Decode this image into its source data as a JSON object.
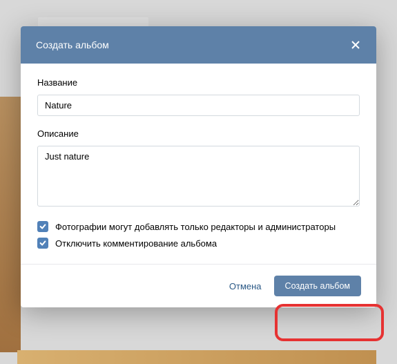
{
  "modal": {
    "title": "Создать альбом",
    "name_label": "Название",
    "name_value": "Nature",
    "description_label": "Описание",
    "description_value": "Just nature",
    "checkbox1_label": "Фотографии могут добавлять только редакторы и администраторы",
    "checkbox2_label": "Отключить комментирование альбома",
    "cancel_label": "Отмена",
    "submit_label": "Создать альбом"
  }
}
